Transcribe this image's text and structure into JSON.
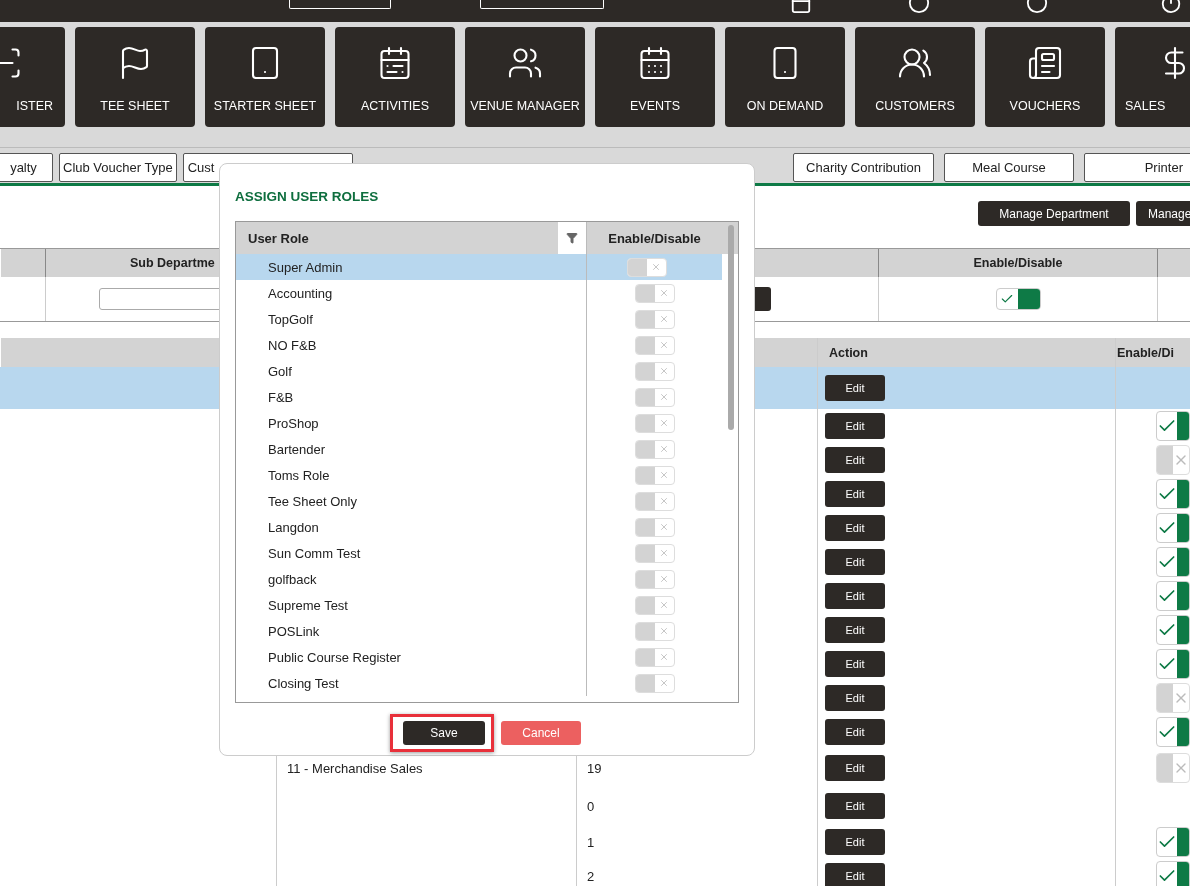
{
  "nav_tiles": [
    {
      "label": "ISTER"
    },
    {
      "label": "TEE SHEET"
    },
    {
      "label": "STARTER SHEET"
    },
    {
      "label": "ACTIVITIES"
    },
    {
      "label": "VENUE MANAGER"
    },
    {
      "label": "EVENTS"
    },
    {
      "label": "ON DEMAND"
    },
    {
      "label": "CUSTOMERS"
    },
    {
      "label": "VOUCHERS"
    },
    {
      "label": "SALES"
    }
  ],
  "tabs_left": [
    {
      "label": "yalty"
    },
    {
      "label": "Club Voucher Type"
    },
    {
      "label": "Cust"
    }
  ],
  "tabs_right": [
    {
      "label": "Charity Contribution"
    },
    {
      "label": "Meal Course"
    },
    {
      "label": "Printer"
    }
  ],
  "actions": [
    {
      "label": "Manage Department"
    },
    {
      "label": "Manage"
    }
  ],
  "filter_table": {
    "columns": [
      "Sub Departme",
      "Enable/Disable"
    ],
    "enabled": true
  },
  "list_table": {
    "columns": [
      "Action",
      "Enable/Di"
    ],
    "rows": [
      {
        "selected": true,
        "action": "Edit"
      },
      {
        "selected": false,
        "action": "Edit",
        "enabled": true
      },
      {
        "selected": false,
        "action": "Edit",
        "enabled": false
      },
      {
        "selected": false,
        "action": "Edit",
        "enabled": true
      },
      {
        "selected": false,
        "action": "Edit",
        "enabled": true
      },
      {
        "selected": false,
        "action": "Edit",
        "enabled": true
      },
      {
        "selected": false,
        "action": "Edit",
        "enabled": true
      },
      {
        "selected": false,
        "action": "Edit",
        "enabled": true
      },
      {
        "selected": false,
        "action": "Edit",
        "enabled": true
      },
      {
        "selected": false,
        "action": "Edit",
        "enabled": false
      },
      {
        "selected": false,
        "action": "Edit",
        "enabled": true
      },
      {
        "selected": false,
        "action": "Edit",
        "enabled": false,
        "name": "11 - Merchandise Sales",
        "code": "19"
      },
      {
        "selected": false,
        "action": "Edit",
        "code": "0"
      },
      {
        "selected": false,
        "action": "Edit",
        "enabled": true,
        "code": "1"
      },
      {
        "selected": false,
        "action": "Edit",
        "enabled": true,
        "code": "2"
      }
    ]
  },
  "dialog": {
    "title": "ASSIGN USER ROLES",
    "columns": [
      "User Role",
      "Enable/Disable"
    ],
    "roles": [
      {
        "name": "Super Admin",
        "selected": true,
        "enabled": false
      },
      {
        "name": "Accounting",
        "selected": false,
        "enabled": false
      },
      {
        "name": "TopGolf",
        "selected": false,
        "enabled": false
      },
      {
        "name": "NO F&B",
        "selected": false,
        "enabled": false
      },
      {
        "name": "Golf",
        "selected": false,
        "enabled": false
      },
      {
        "name": "F&B",
        "selected": false,
        "enabled": false
      },
      {
        "name": "ProShop",
        "selected": false,
        "enabled": false
      },
      {
        "name": "Bartender",
        "selected": false,
        "enabled": false
      },
      {
        "name": "Toms Role",
        "selected": false,
        "enabled": false
      },
      {
        "name": "Tee Sheet Only",
        "selected": false,
        "enabled": false
      },
      {
        "name": "Langdon",
        "selected": false,
        "enabled": false
      },
      {
        "name": "Sun Comm Test",
        "selected": false,
        "enabled": false
      },
      {
        "name": "golfback",
        "selected": false,
        "enabled": false
      },
      {
        "name": "Supreme Test",
        "selected": false,
        "enabled": false
      },
      {
        "name": "POSLink",
        "selected": false,
        "enabled": false
      },
      {
        "name": "Public Course Register",
        "selected": false,
        "enabled": false
      },
      {
        "name": "Closing Test",
        "selected": false,
        "enabled": false
      }
    ],
    "buttons": [
      {
        "label": "Save",
        "kind": "primary",
        "highlighted": true
      },
      {
        "label": "Cancel",
        "kind": "danger",
        "highlighted": false
      }
    ]
  }
}
